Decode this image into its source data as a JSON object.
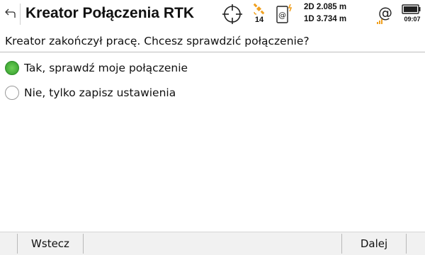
{
  "header": {
    "title": "Kreator Połączenia RTK",
    "satellites": "14",
    "precision_2d": "2D 2.085 m",
    "precision_1d": "1D 3.734 m",
    "time": "09:07",
    "icons": [
      "back-arrow-icon",
      "crosshair-icon",
      "satellite-icon",
      "device-radio-icon",
      "network-at-icon",
      "battery-icon"
    ],
    "accent_color": "#f0a020"
  },
  "main": {
    "question": "Kreator zakończył pracę. Chcesz sprawdzić połączenie?",
    "options": [
      {
        "label": "Tak, sprawdź moje połączenie",
        "selected": true
      },
      {
        "label": "Nie, tylko zapisz ustawienia",
        "selected": false
      }
    ],
    "selected_color": "#4cb33e"
  },
  "footer": {
    "back_label": "Wstecz",
    "next_label": "Dalej"
  }
}
